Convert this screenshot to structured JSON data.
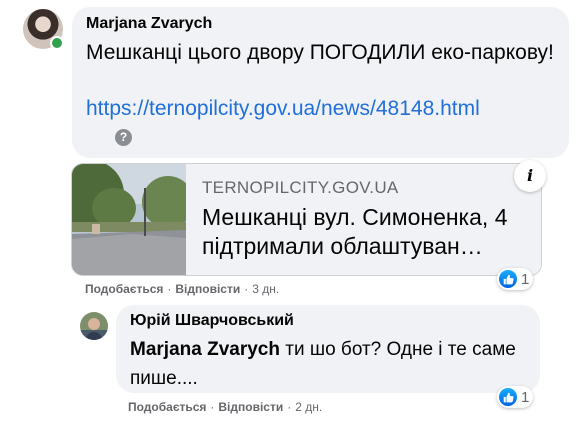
{
  "comment": {
    "author": "Marjana Zvarych",
    "text": "Мешканці цього двору ПОГОДИЛИ еко-паркову!",
    "link": "https://ternopilcity.gov.ua/news/48148.html",
    "help_icon": "?",
    "preview": {
      "domain": "TERNOPILCITY.GOV.UA",
      "title": "Мешканці вул. Симоненка, 4 підтримали облаштуван…",
      "info_icon": "i"
    },
    "reactions": {
      "icon": "like-icon",
      "count": "1"
    },
    "actions": {
      "like": "Подобається",
      "reply": "Відповісти",
      "time": "3 дн."
    }
  },
  "reply": {
    "author": "Юрій Шварчовський",
    "mention": "Marjana Zvarych",
    "text": " ти шо бот? Одне і те саме пише....",
    "reactions": {
      "icon": "like-icon",
      "count": "1"
    },
    "actions": {
      "like": "Подобається",
      "reply": "Відповісти",
      "time": "2 дн."
    }
  },
  "colors": {
    "bubble": "#f0f2f5",
    "link": "#216fdb",
    "secondary_text": "#65676b",
    "like_blue": "#0571ed",
    "online_green": "#31a24c"
  }
}
